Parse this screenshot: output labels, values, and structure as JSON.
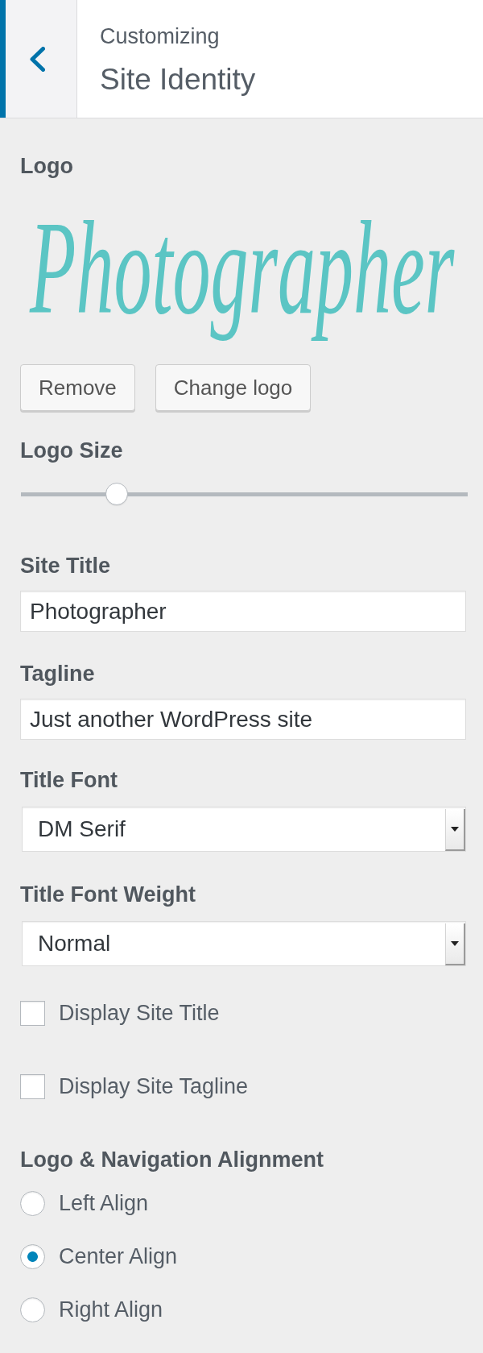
{
  "header": {
    "breadcrumb": "Customizing",
    "title": "Site Identity"
  },
  "controls": [
    {
      "kind": "logo",
      "label": "Logo",
      "logo_text": "Photographer",
      "buttons": [
        "Remove",
        "Change logo"
      ]
    },
    {
      "kind": "slider",
      "label": "Logo Size",
      "level": 0.2
    },
    {
      "kind": "text",
      "label": "Site Title",
      "value": "Photographer"
    },
    {
      "kind": "text",
      "label": "Tagline",
      "value": "Just another WordPress site"
    },
    {
      "kind": "select",
      "label": "Title Font",
      "value": "DM Serif"
    },
    {
      "kind": "select",
      "label": "Title Font Weight",
      "value": "Normal"
    },
    {
      "kind": "checkbox",
      "label": "Display Site Title",
      "checked": false
    },
    {
      "kind": "checkbox",
      "label": "Display Site Tagline",
      "checked": false
    },
    {
      "kind": "radio",
      "label": "Logo & Navigation Alignment",
      "options": [
        {
          "label": "Left Align",
          "selected": false
        },
        {
          "label": "Center Align",
          "selected": true
        },
        {
          "label": "Right Align",
          "selected": false
        }
      ]
    }
  ]
}
